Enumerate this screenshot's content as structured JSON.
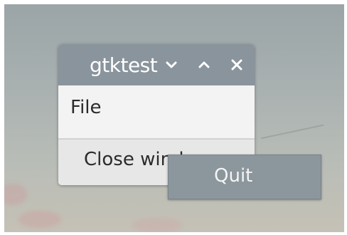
{
  "window": {
    "title": "gtktest",
    "menu": {
      "file_label": "File"
    },
    "close_button_label": "Close window"
  },
  "popup_menu": {
    "items": [
      {
        "label": "Quit"
      }
    ]
  },
  "icons": {
    "menu": "chevron-down-icon",
    "maximize": "chevron-up-icon",
    "close": "close-icon"
  },
  "colors": {
    "titlebar": "#8a949c",
    "popup": "#8c969d",
    "window_bg": "#f2f2f2"
  }
}
